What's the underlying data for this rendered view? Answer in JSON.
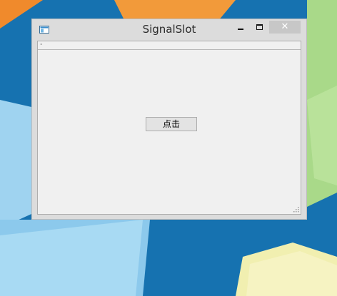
{
  "window": {
    "title": "SignalSlot",
    "close_glyph": "✕",
    "app_icon": "application-window-icon"
  },
  "main": {
    "button_label": "点击"
  },
  "colors": {
    "close_button_bg": "#c7c7c7",
    "window_frame": "#dcdcdc",
    "client_bg": "#f0f0f0"
  }
}
